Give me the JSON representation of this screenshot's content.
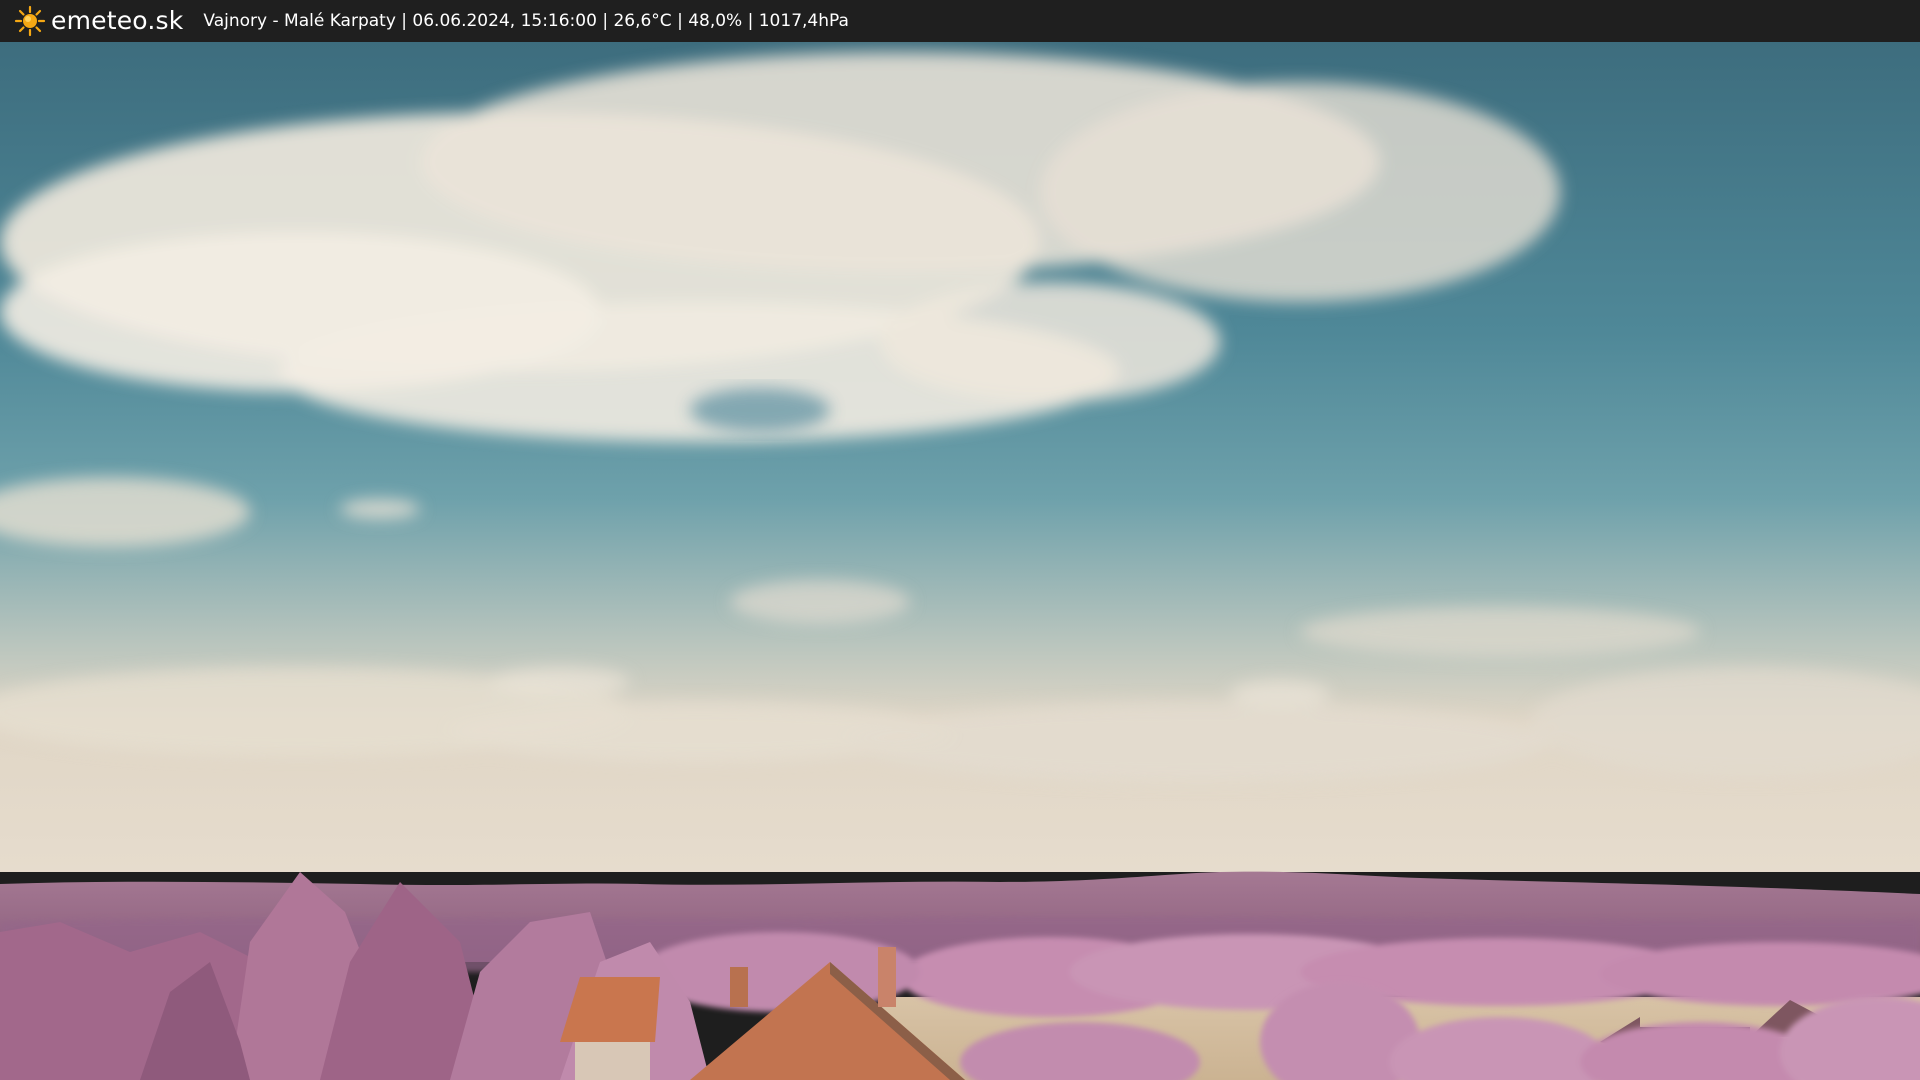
{
  "header": {
    "logo_icon": "sun-icon",
    "brand": "emeteo.sk",
    "caption": "Vajnory - Malé Karpaty | 06.06.2024, 15:16:00 | 26,6°C | 48,0% | 1017,4hPa"
  },
  "colors": {
    "bar": "#1f1f1f",
    "sun": "#f5a814",
    "sky_top": "#3e6f80",
    "sky_mid": "#5f97a4",
    "horizon": "#ddd4c4",
    "hills": "#9b6d8a",
    "foliage": "#c58db0",
    "roof": "#c97a52",
    "field": "#d6c1a3"
  }
}
